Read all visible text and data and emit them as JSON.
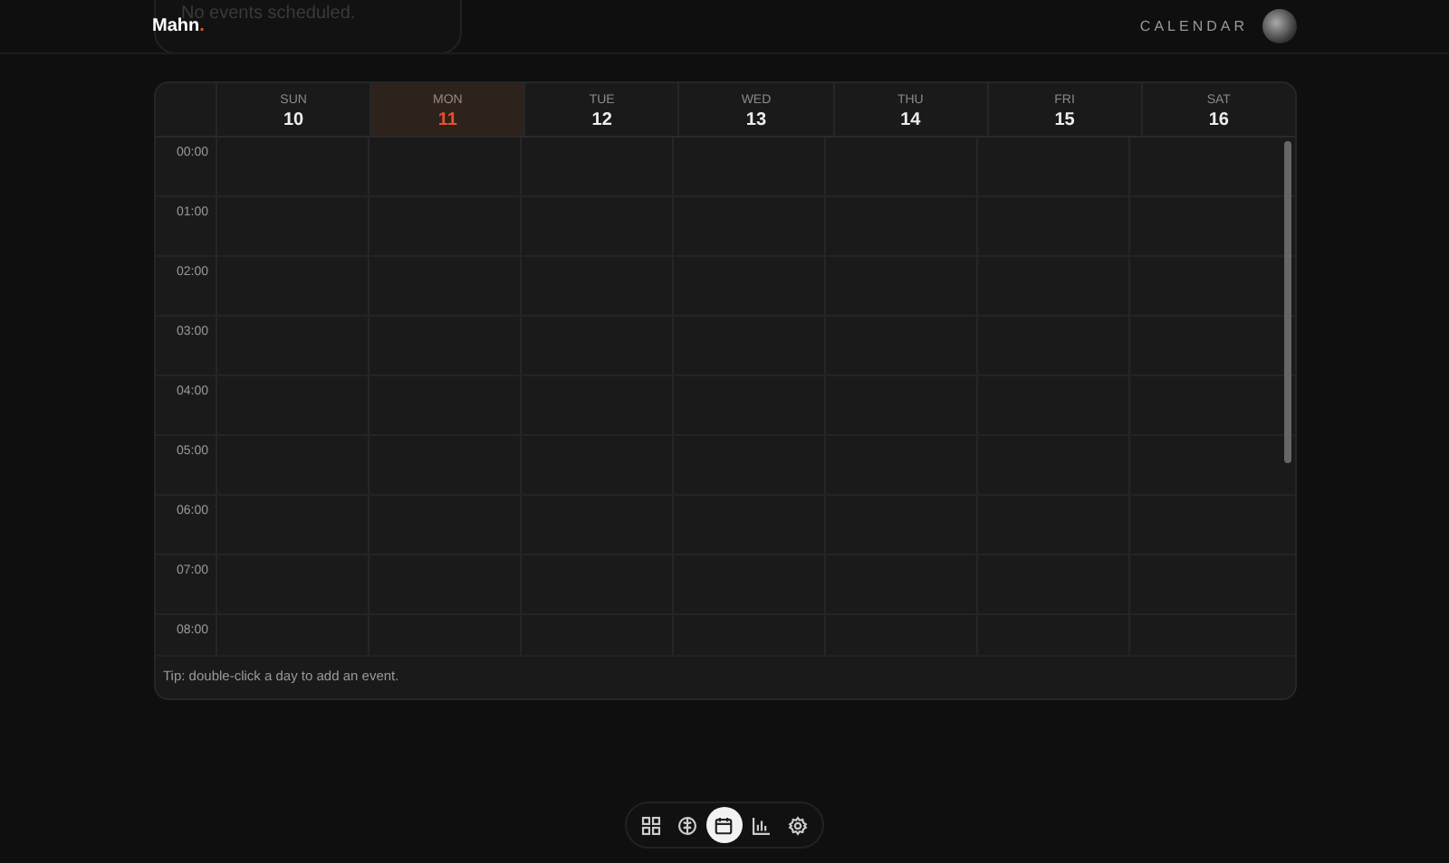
{
  "background_panel": {
    "text": "No events scheduled."
  },
  "header": {
    "logo": "Mahn",
    "logo_accent": ".",
    "page_label": "CALENDAR"
  },
  "calendar": {
    "days": [
      {
        "weekday": "SUN",
        "date": "10",
        "selected": false
      },
      {
        "weekday": "MON",
        "date": "11",
        "selected": true
      },
      {
        "weekday": "TUE",
        "date": "12",
        "selected": false
      },
      {
        "weekday": "WED",
        "date": "13",
        "selected": false
      },
      {
        "weekday": "THU",
        "date": "14",
        "selected": false
      },
      {
        "weekday": "FRI",
        "date": "15",
        "selected": false
      },
      {
        "weekday": "SAT",
        "date": "16",
        "selected": false
      }
    ],
    "hours": [
      "00:00",
      "01:00",
      "02:00",
      "03:00",
      "04:00",
      "05:00",
      "06:00",
      "07:00",
      "08:00"
    ],
    "tip": "Tip: double-click a day to add an event."
  },
  "dock": [
    {
      "kind": "grid",
      "selected": false
    },
    {
      "kind": "brain",
      "selected": false
    },
    {
      "kind": "calendar",
      "selected": true
    },
    {
      "kind": "chart",
      "selected": false
    },
    {
      "kind": "settings",
      "selected": false
    }
  ]
}
